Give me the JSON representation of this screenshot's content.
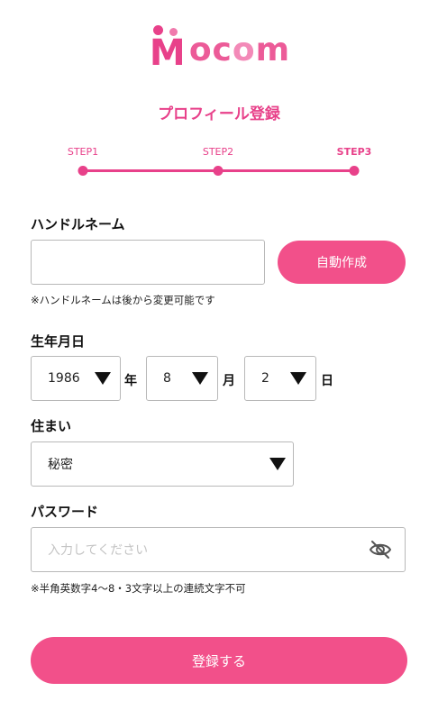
{
  "logo": {
    "mark": "M",
    "text_a": "oc",
    "text_b": "o",
    "text_c": "m"
  },
  "title": "プロフィール登録",
  "steps": [
    {
      "label": "STEP1",
      "active": false
    },
    {
      "label": "STEP2",
      "active": false
    },
    {
      "label": "STEP3",
      "active": true
    }
  ],
  "handle": {
    "label": "ハンドルネーム",
    "value": "",
    "auto_button": "自動作成",
    "note": "※ハンドルネームは後から変更可能です"
  },
  "birthday": {
    "label": "生年月日",
    "year": "1986",
    "year_unit": "年",
    "month": "8",
    "month_unit": "月",
    "day": "2",
    "day_unit": "日"
  },
  "residence": {
    "label": "住まい",
    "value": "秘密"
  },
  "password": {
    "label": "パスワード",
    "placeholder": "入力してください",
    "note": "※半角英数字4〜8・3文字以上の連続文字不可"
  },
  "submit": {
    "label": "登録する"
  },
  "colors": {
    "accent": "#e8418a",
    "button": "#f2508a"
  },
  "icons": {
    "dropdown": "caret-down-icon",
    "visibility": "eye-off-icon"
  }
}
